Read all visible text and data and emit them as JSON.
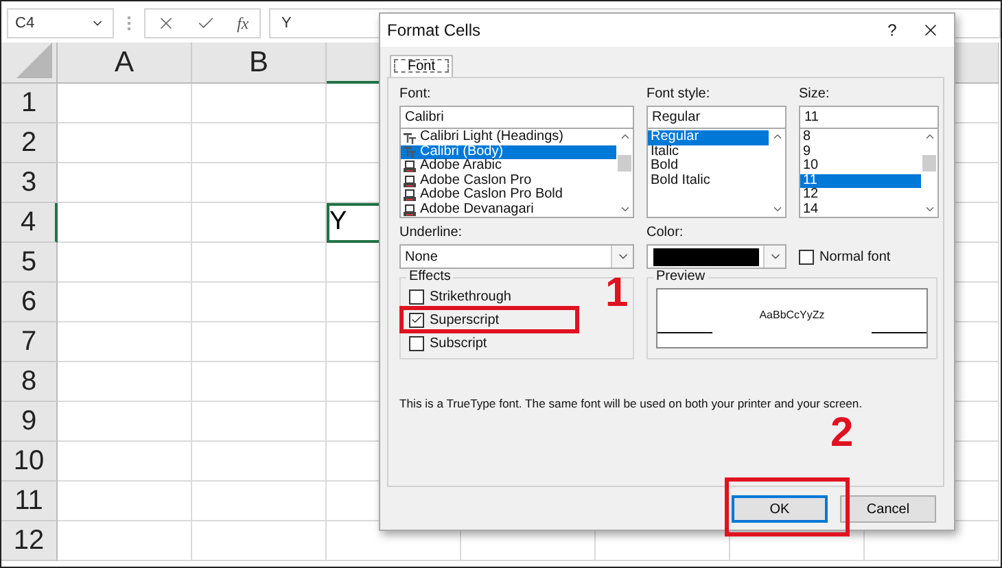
{
  "formula_bar": {
    "name_box": "C4",
    "function_label": "fx",
    "value": "Y"
  },
  "sheet": {
    "columns": [
      {
        "label": "A",
        "selected": false
      },
      {
        "label": "B",
        "selected": false
      },
      {
        "selected": true
      }
    ],
    "rows": [
      {
        "label": "1",
        "selected": false,
        "cells": []
      },
      {
        "label": "2",
        "selected": false,
        "cells": []
      },
      {
        "label": "3",
        "selected": false,
        "cells": []
      },
      {
        "label": "4",
        "selected": true,
        "cells": [
          "",
          "",
          "Y"
        ]
      },
      {
        "label": "5",
        "selected": false,
        "cells": []
      },
      {
        "label": "6",
        "selected": false,
        "cells": []
      },
      {
        "label": "7",
        "selected": false,
        "cells": []
      },
      {
        "label": "8",
        "selected": false,
        "cells": []
      },
      {
        "label": "9",
        "selected": false,
        "cells": []
      },
      {
        "label": "10",
        "selected": false,
        "cells": []
      },
      {
        "label": "11",
        "selected": false,
        "cells": []
      },
      {
        "label": "12",
        "selected": false,
        "cells": []
      }
    ]
  },
  "dialog": {
    "title": "Format Cells",
    "help": "?",
    "tabs": [
      {
        "label": "Font",
        "selected": true
      }
    ],
    "font": {
      "label": "Font:",
      "value": "Calibri",
      "items": [
        {
          "label": "Calibri Light (Headings)",
          "kind": "truetype",
          "selected": false
        },
        {
          "label": "Calibri (Body)",
          "kind": "truetype",
          "selected": true
        },
        {
          "label": "Adobe Arabic",
          "kind": "printer",
          "selected": false
        },
        {
          "label": "Adobe Caslon Pro",
          "kind": "printer",
          "selected": false
        },
        {
          "label": "Adobe Caslon Pro Bold",
          "kind": "printer",
          "selected": false
        },
        {
          "label": "Adobe Devanagari",
          "kind": "printer",
          "selected": false
        }
      ]
    },
    "font_style": {
      "label": "Font style:",
      "value": "Regular",
      "items": [
        {
          "label": "Regular",
          "selected": true
        },
        {
          "label": "Italic",
          "selected": false
        },
        {
          "label": "Bold",
          "selected": false
        },
        {
          "label": "Bold Italic",
          "selected": false
        }
      ]
    },
    "size": {
      "label": "Size:",
      "value": "11",
      "items": [
        {
          "label": "8",
          "selected": false
        },
        {
          "label": "9",
          "selected": false
        },
        {
          "label": "10",
          "selected": false
        },
        {
          "label": "11",
          "selected": true
        },
        {
          "label": "12",
          "selected": false
        },
        {
          "label": "14",
          "selected": false
        }
      ]
    },
    "underline": {
      "label": "Underline:",
      "value": "None"
    },
    "color": {
      "label": "Color:",
      "color": "#000000"
    },
    "normal_font": {
      "label": "Normal font",
      "checked": false
    },
    "effects": {
      "title": "Effects",
      "items": [
        {
          "label": "Strikethrough",
          "checked": false
        },
        {
          "label": "Superscript",
          "checked": true
        },
        {
          "label": "Subscript",
          "checked": false
        }
      ]
    },
    "preview": {
      "title": "Preview",
      "sample": "AaBbCcYyZz"
    },
    "info": "This is a TrueType font.  The same font will be used on both your printer and your screen.",
    "buttons": [
      {
        "label": "OK",
        "default": true
      },
      {
        "label": "Cancel",
        "default": false
      }
    ]
  },
  "annotations": [
    {
      "label": "1"
    },
    {
      "label": "2"
    }
  ]
}
